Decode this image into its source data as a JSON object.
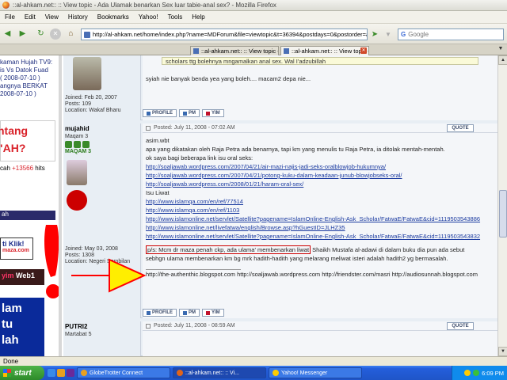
{
  "window": {
    "title": "::al-ahkam.net:: :: View topic - Ada Ulamak benarkan Sex luar tabie-anal sex? - Mozilla Firefox"
  },
  "menu": [
    "File",
    "Edit",
    "View",
    "History",
    "Bookmarks",
    "Yahoo!",
    "Tools",
    "Help"
  ],
  "nav": {
    "url": "http://al-ahkam.net/home/index.php?name=MDForum&file=viewtopic&t=36394&postdays=0&postorder=as",
    "search_placeholder": "Google",
    "search_engine": "G"
  },
  "tabs": [
    {
      "label": "::al-ahkam.net:: :: View topic - Ada...",
      "active": false
    },
    {
      "label": "::al-ahkam.net:: :: View topic - Ada...",
      "active": true
    }
  ],
  "sidebar": {
    "lines": [
      "kaman Hujah TV9:",
      "is Vs Datok Fuad",
      "( 2008-07-10 )",
      "",
      "angnya BERKAT",
      "2008-07-10 )"
    ],
    "ad1_line1": "ntang",
    "ad1_line2": "\"AH?",
    "counter_prefix": "cah ",
    "counter_value": "+13566",
    "counter_suffix": " hits",
    "section_header": "ah",
    "klik_text": "ti Klik!",
    "klik_sub": "maza.com",
    "web1_a": "yim ",
    "web1_b": "Web1",
    "blue_text": "lam\ntu\nlah"
  },
  "posts": [
    {
      "joined": "Joined: Feb 20, 2007",
      "posts": "Posts: 109",
      "location": "Location: Wakaf Bharu",
      "quote_text": "scholars ttg bolehnya mngamalkan anal sex.  Wal I'adzubillah",
      "body": "syiah nie banyak benda yea yang boleh.... macam2 depa nie...",
      "buttons": [
        "PROFILE",
        "PM",
        "YIM"
      ]
    },
    {
      "username": "mujahid",
      "rank": "Maqam 3",
      "rank_label": "MAQAM 3",
      "joined": "Joined: May 03, 2008",
      "posts": "Posts: 1308",
      "location": "Location: Negeri Sembilan",
      "posted": "Posted: July 11, 2008 - 07:02 AM",
      "quote_btn": "QUOTE",
      "lines": [
        "asim.wbt",
        "",
        "apa yang dikatakan oleh Raja Petra ada benarnya, tapi km yang menulis tu Raja Petra, ia ditolak mentah-mentah.",
        "",
        "ok saya bagi beberapa link isu oral seks:",
        "",
        "http://soaljawab.wordpress.com/2007/04/21/air-mazi-najis-jadi-seks-oralblowjob-hukumnya/",
        "http://soaljawab.wordpress.com/2007/04/21/potong-kuku-dalam-keadaan-junub-blowjobseks-oral/",
        "http://soaljawab.wordpress.com/2008/01/21/haram-oral-sex/",
        "",
        "Isu Liwat",
        "http://www.islamqa.com/en/ref/77514",
        "http://www.islamqa.com/en/ref/1103",
        "http://www.islamonline.net/servlet/Satellite?pagename=IslamOnline-English-Ask_Scholar/FatwaE/FatwaE&cid=1119503543886",
        "http://www.islamonline.net/livefatwa/english/Browse.asp?hGuestID=JLHZ35",
        "http://www.islamonline.net/servlet/Satellite?pagename=IslamOnline-English-Ask_Scholar/FatwaE/FatwaE&cid=1119503543832"
      ],
      "ps_highlight": "p/s: Mcm dr maza penah ckp, ada ulama' membenarkan liwat",
      "ps_rest": " Shaikh Mustafa al-adawi di dalam buku dia pun ada sebut",
      "ps_line2": "sebhgn ulama membenarkan km bg mrk hadith-hadith yang melarang meliwat isteri adalah hadith2 yg bermasalah.",
      "signature": "http://the-authenthic.blogspot.com  http://soaljawab.wordpress.com  http://friendster.com/masri  http://audiosunnah.blogspot.com",
      "buttons": [
        "PROFILE",
        "PM",
        "YIM"
      ]
    },
    {
      "username": "PUTRI2",
      "rank": "Martabat 5",
      "posted": "Posted: July 11, 2008 - 08:59 AM",
      "quote_btn": "QUOTE"
    }
  ],
  "status": "Done",
  "taskbar": {
    "start": "start",
    "items": [
      {
        "label": "GlobeTrotter Connect",
        "active": false
      },
      {
        "label": "::al-ahkam.net:: :: Vi...",
        "active": true
      },
      {
        "label": "Yahoo! Messenger",
        "active": false
      }
    ],
    "clock": "6:09 PM"
  },
  "colors": {
    "accent_red": "#d9222a",
    "link_blue": "#1a3aa0",
    "taskbar_blue": "#245edb",
    "highlight_box": "#cc0000",
    "annotation_arrow": "#ffee00"
  }
}
